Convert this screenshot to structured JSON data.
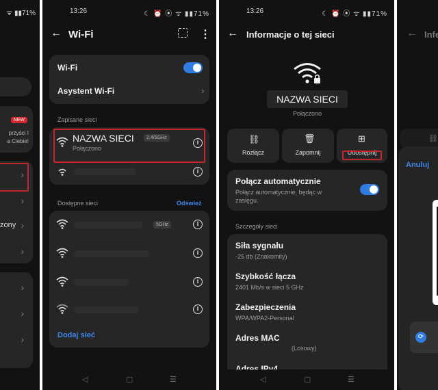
{
  "status": {
    "time": "13:26",
    "battery": "71%",
    "icons": "☾ ⏰ ⦿ ᯤ ▮▮▮ 🔋"
  },
  "panel1": {
    "badge_new": "NEW",
    "promo_line1": "przyści I",
    "promo_line2": "a Ciebie!",
    "item_label": "zony"
  },
  "panel2": {
    "title": "Wi-Fi",
    "wifi_toggle_label": "Wi-Fi",
    "wifi_assistant_label": "Asystent Wi-Fi",
    "saved_section": "Zapisane sieci",
    "saved_network_name": "NAZWA SIECI",
    "saved_network_band": "2.4/5GHz",
    "saved_network_status": "Połączono",
    "available_section": "Dostępne sieci",
    "refresh_label": "Odśwież",
    "available_band": "5GHz",
    "add_network_label": "Dodaj sieć"
  },
  "panel3": {
    "title": "Informacje o tej sieci",
    "network_name": "NAZWA SIECI",
    "network_status": "Połączono",
    "disconnect_label": "Rozłącz",
    "forget_label": "Zapomnij",
    "share_label": "Udostępnij",
    "auto_connect_title": "Połącz automatycznie",
    "auto_connect_desc_line1": "Połącz automatycznie, będąc w",
    "auto_connect_desc_line2": "zasięgu.",
    "details_section": "Szczegóły sieci",
    "signal_label": "Siła sygnału",
    "signal_value": "-25 db (Znakomity)",
    "link_speed_label": "Szybkość łącza",
    "link_speed_value": "2401 Mb/s w sieci 5 GHz",
    "security_label": "Zabezpieczenia",
    "security_value": "WPA/WPA2-Personal",
    "mac_label": "Adres MAC",
    "mac_value": "(Losowy)",
    "ipv4_label": "Adres IPv4"
  },
  "panel4": {
    "title": "Infe",
    "cancel_label": "Anuluj"
  },
  "colors": {
    "accent": "#3e86e8",
    "highlight": "#c4262e",
    "background": "#121212",
    "card": "#262626"
  }
}
